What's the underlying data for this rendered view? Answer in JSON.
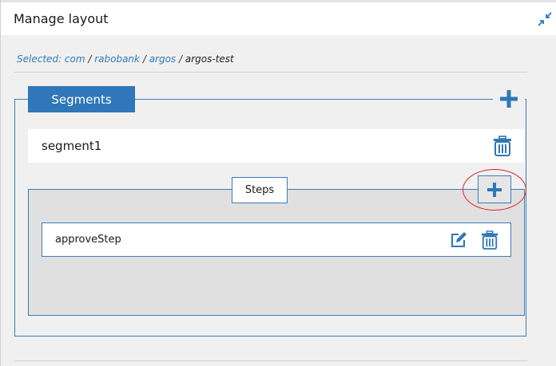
{
  "window": {
    "title": "Manage layout",
    "collapse_icon": "collapse-arrows-icon"
  },
  "breadcrumb": {
    "prefix": "Selected:",
    "items": [
      "com",
      "rabobank",
      "argos"
    ],
    "current": "argos-test",
    "separator": "/"
  },
  "segments": {
    "legend": "Segments",
    "add_icon": "plus-icon",
    "items": [
      {
        "name": "segment1",
        "delete_icon": "trash-icon",
        "steps": {
          "legend": "Steps",
          "add_icon": "plus-icon",
          "items": [
            {
              "name": "approveStep",
              "edit_icon": "edit-icon",
              "delete_icon": "trash-icon"
            }
          ]
        }
      }
    ]
  },
  "colors": {
    "accent": "#2f77b8",
    "highlight": "#d9262e",
    "panel_bg": "#e0e0e0"
  }
}
